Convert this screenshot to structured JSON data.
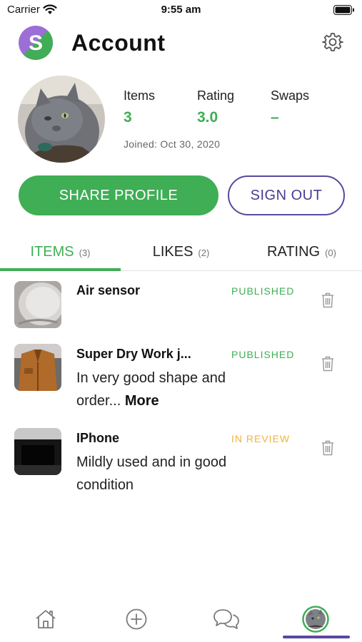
{
  "status_bar": {
    "carrier": "Carrier",
    "time": "9:55 am"
  },
  "header": {
    "title": "Account",
    "logo_letter": "S"
  },
  "profile": {
    "stats": [
      {
        "label": "Items",
        "value": "3"
      },
      {
        "label": "Rating",
        "value": "3.0"
      },
      {
        "label": "Swaps",
        "value": "–"
      }
    ],
    "joined": "Joined: Oct 30, 2020"
  },
  "buttons": {
    "share": "SHARE PROFILE",
    "signout": "SIGN OUT"
  },
  "tabs": [
    {
      "label": "ITEMS",
      "count": "(3)",
      "active": true
    },
    {
      "label": "LIKES",
      "count": "(2)",
      "active": false
    },
    {
      "label": "RATING",
      "count": "(0)",
      "active": false
    }
  ],
  "items": [
    {
      "title": "Air sensor",
      "status": "PUBLISHED",
      "description": "",
      "more": ""
    },
    {
      "title": "Super Dry Work j...",
      "status": "PUBLISHED",
      "description": "In very good shape and order...",
      "more": "More"
    },
    {
      "title": "IPhone",
      "status": "IN REVIEW",
      "description": "Mildly used and in good condition",
      "more": ""
    }
  ],
  "bottom_nav": [
    {
      "icon": "home-icon"
    },
    {
      "icon": "plus-circle-icon"
    },
    {
      "icon": "chat-bubbles-icon"
    },
    {
      "icon": "profile-avatar-icon",
      "active": true
    }
  ],
  "colors": {
    "accent_green": "#3fae55",
    "accent_purple": "#5a48a0",
    "review_orange": "#f0b43c"
  }
}
